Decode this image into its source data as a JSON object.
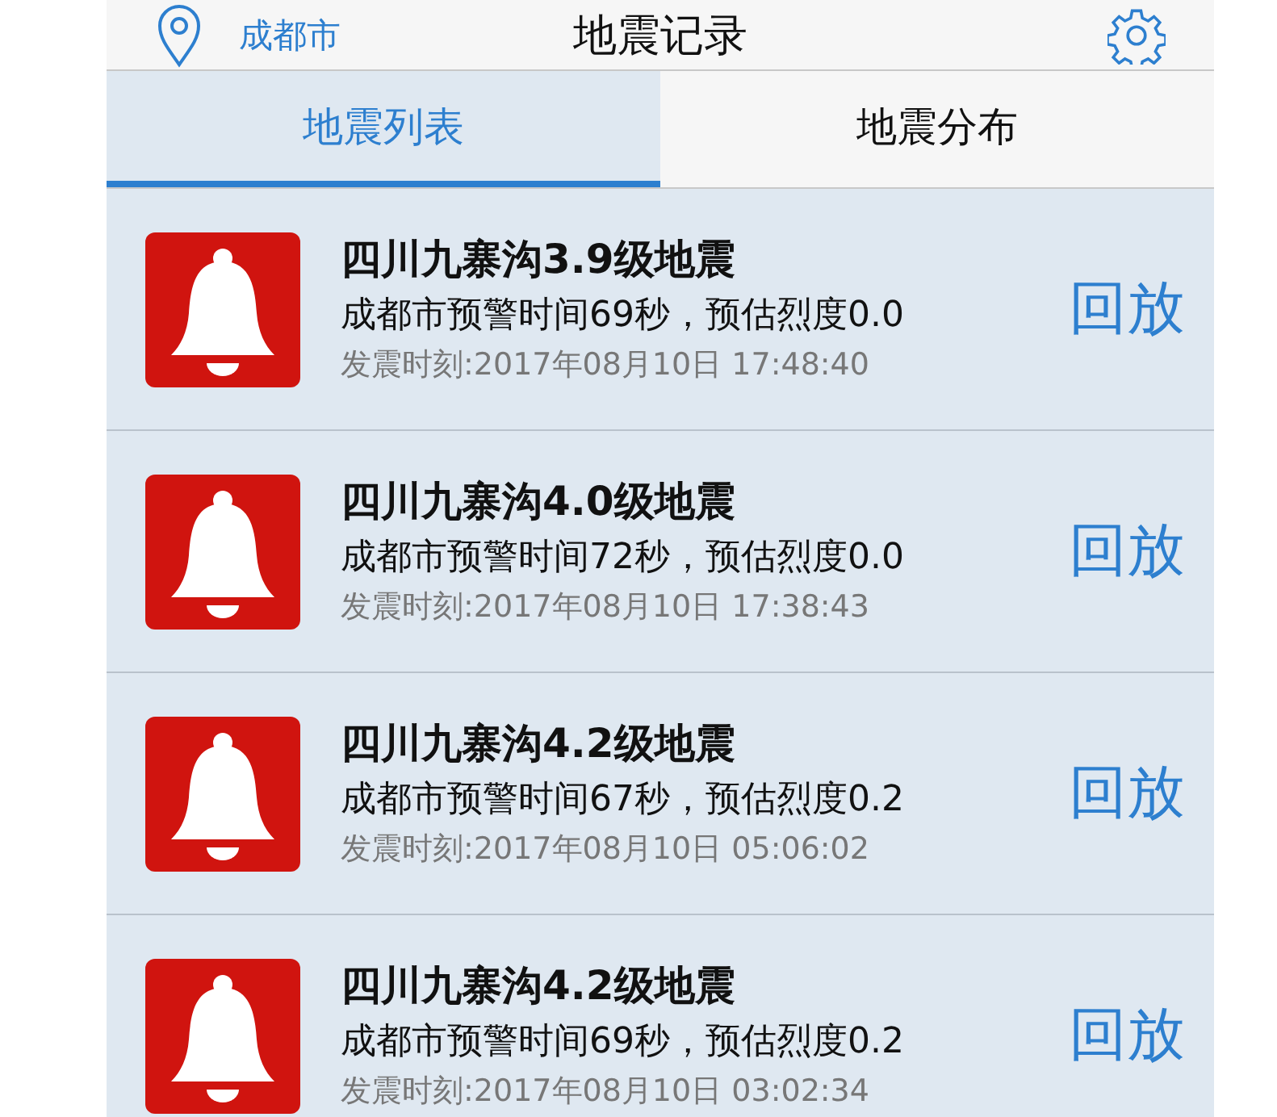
{
  "header": {
    "location": "成都市",
    "title": "地震记录"
  },
  "tabs": [
    {
      "label": "地震列表",
      "selected": true
    },
    {
      "label": "地震分布",
      "selected": false
    }
  ],
  "records": [
    {
      "title": "四川九寨沟3.9级地震",
      "warning": "成都市预警时间69秒，预估烈度0.0",
      "time": "发震时刻:2017年08月10日 17:48:40",
      "action": "回放"
    },
    {
      "title": "四川九寨沟4.0级地震",
      "warning": "成都市预警时间72秒，预估烈度0.0",
      "time": "发震时刻:2017年08月10日 17:38:43",
      "action": "回放"
    },
    {
      "title": "四川九寨沟4.2级地震",
      "warning": "成都市预警时间67秒，预估烈度0.2",
      "time": "发震时刻:2017年08月10日 05:06:02",
      "action": "回放"
    },
    {
      "title": "四川九寨沟4.2级地震",
      "warning": "成都市预警时间69秒，预估烈度0.2",
      "time": "发震时刻:2017年08月10日 03:02:34",
      "action": "回放"
    }
  ]
}
